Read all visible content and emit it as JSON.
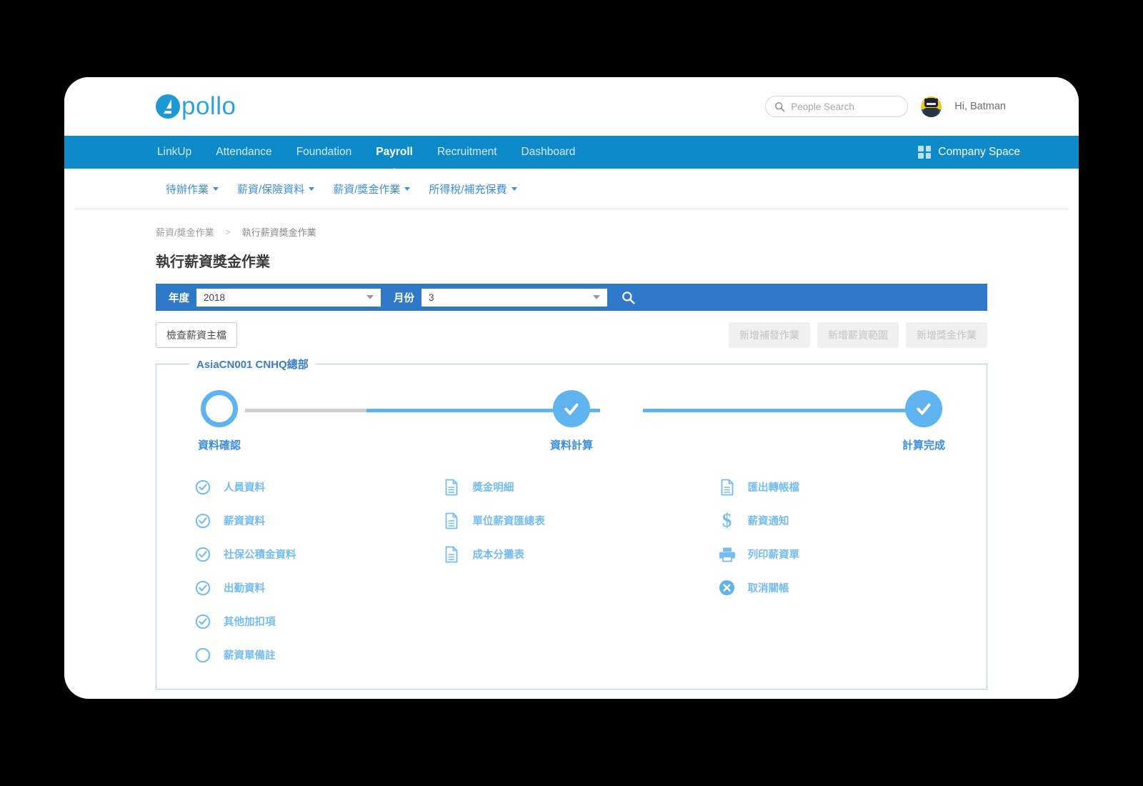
{
  "brand": {
    "name": "pollo",
    "logo_icon": "apollo-logo-icon"
  },
  "header": {
    "search": {
      "placeholder": "People Search",
      "value": "",
      "icon": "search-icon"
    },
    "greeting": "Hi, Batman",
    "avatar_icon": "batman-avatar"
  },
  "mainnav": {
    "items": [
      {
        "label": "LinkUp",
        "active": false
      },
      {
        "label": "Attendance",
        "active": false
      },
      {
        "label": "Foundation",
        "active": false
      },
      {
        "label": "Payroll",
        "active": true
      },
      {
        "label": "Recruitment",
        "active": false
      },
      {
        "label": "Dashboard",
        "active": false
      }
    ],
    "company_space": {
      "label": "Company Space",
      "icon": "grid-icon"
    }
  },
  "submenu": {
    "items": [
      {
        "label": "待辦作業"
      },
      {
        "label": "薪資/保險資料"
      },
      {
        "label": "薪資/獎金作業"
      },
      {
        "label": "所得稅/補充保費"
      }
    ]
  },
  "breadcrumb": {
    "parent": "薪資/獎金作業",
    "separator": ">",
    "current": "執行薪資獎金作業"
  },
  "page": {
    "title": "執行薪資獎金作業"
  },
  "filterbar": {
    "year_label": "年度",
    "year_value": "2018",
    "month_label": "月份",
    "month_value": "3",
    "search_icon": "search-icon"
  },
  "actions": {
    "check_master": "檢查薪資主檔",
    "disabled_buttons": [
      {
        "label": "新增補發作業"
      },
      {
        "label": "新增薪資範圍"
      },
      {
        "label": "新增獎金作業"
      }
    ]
  },
  "group": {
    "legend": "AsiaCN001 CNHQ總部",
    "steps": [
      {
        "label": "資料確認",
        "state": "pending"
      },
      {
        "label": "資料計算",
        "state": "done"
      },
      {
        "label": "計算完成",
        "state": "done"
      }
    ],
    "columns": [
      {
        "items": [
          {
            "label": "人員資料",
            "icon": "check-circle-icon"
          },
          {
            "label": "薪資資料",
            "icon": "check-circle-icon"
          },
          {
            "label": "社保公積金資料",
            "icon": "check-circle-icon"
          },
          {
            "label": "出勤資料",
            "icon": "check-circle-icon"
          },
          {
            "label": "其他加扣項",
            "icon": "check-circle-icon"
          },
          {
            "label": "薪資單備註",
            "icon": "empty-circle-icon"
          }
        ]
      },
      {
        "items": [
          {
            "label": "獎金明細",
            "icon": "document-icon"
          },
          {
            "label": "單位薪資匯總表",
            "icon": "document-icon"
          },
          {
            "label": "成本分攤表",
            "icon": "document-icon"
          }
        ]
      },
      {
        "items": [
          {
            "label": "匯出轉帳檔",
            "icon": "document-icon"
          },
          {
            "label": "薪資通知",
            "icon": "dollar-icon"
          },
          {
            "label": "列印薪資單",
            "icon": "printer-icon"
          },
          {
            "label": "取消關帳",
            "icon": "cancel-circle-icon"
          }
        ]
      }
    ]
  },
  "colors": {
    "nav_blue": "#0e8ac9",
    "filter_blue": "#2f79c9",
    "accent_light_blue": "#74bdf2",
    "link_blue": "#3c8dde",
    "avatar_yellow": "#f5c518"
  }
}
